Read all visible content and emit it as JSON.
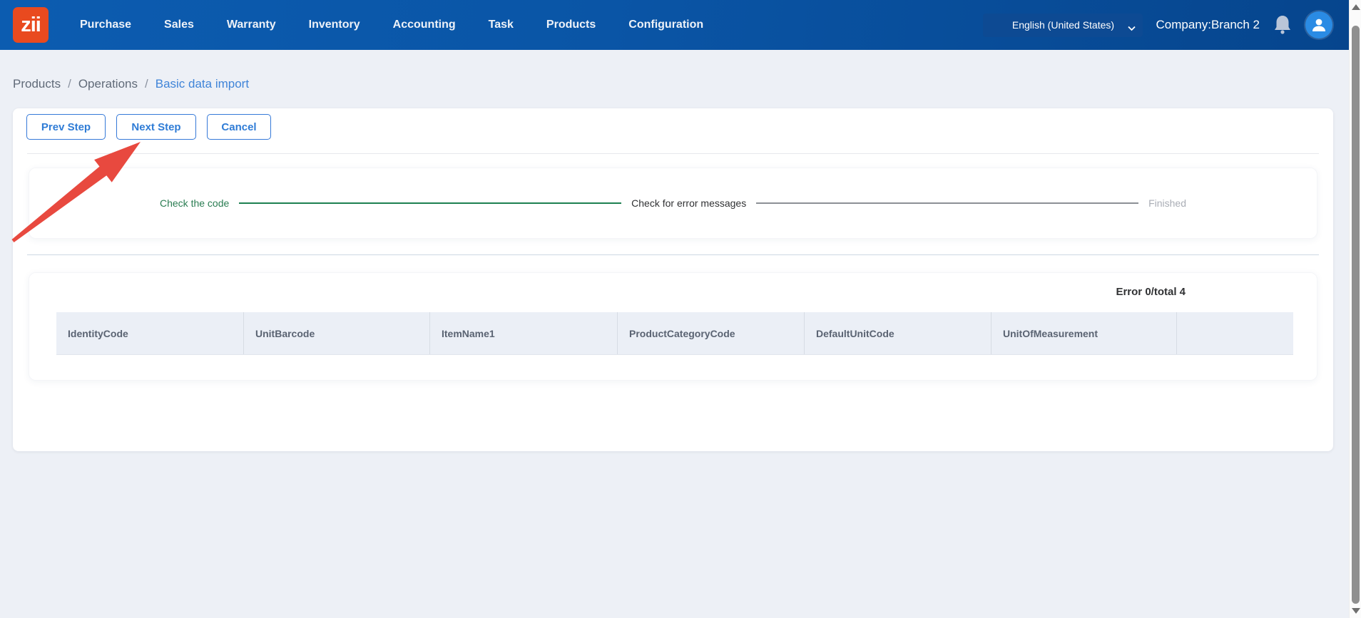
{
  "navbar": {
    "logo_text": "zii",
    "items": [
      {
        "label": "Purchase"
      },
      {
        "label": "Sales"
      },
      {
        "label": "Warranty"
      },
      {
        "label": "Inventory"
      },
      {
        "label": "Accounting"
      },
      {
        "label": "Task"
      },
      {
        "label": "Products"
      },
      {
        "label": "Configuration"
      }
    ],
    "language_selector": {
      "value": "English (United States)"
    },
    "company_label": "Company:Branch 2"
  },
  "breadcrumb": {
    "separator": "/",
    "items": [
      {
        "label": "Products"
      },
      {
        "label": "Operations"
      },
      {
        "label": "Basic data import"
      }
    ]
  },
  "toolbar": {
    "prev_label": "Prev Step",
    "next_label": "Next Step",
    "cancel_label": "Cancel"
  },
  "stepper": {
    "steps": [
      {
        "label": "Check the code",
        "state": "done"
      },
      {
        "label": "Check for error messages",
        "state": "current"
      },
      {
        "label": "Finished",
        "state": "pending"
      }
    ]
  },
  "summary": {
    "error_total_label": "Error 0/total 4"
  },
  "table": {
    "columns": [
      "IdentityCode",
      "UnitBarcode",
      "ItemName1",
      "ProductCategoryCode",
      "DefaultUnitCode",
      "UnitOfMeasurement",
      ""
    ],
    "rows": []
  },
  "annotation": {
    "type": "arrow",
    "color": "#e8493f",
    "points_to": "next-step-button"
  },
  "colors": {
    "navbar_blue": "#0a55a6",
    "logo_orange": "#e94a1f",
    "accent_blue": "#2f7cd6",
    "step_green": "#1d8050",
    "page_background": "#edf0f6",
    "header_row_background": "#ebeff6"
  }
}
